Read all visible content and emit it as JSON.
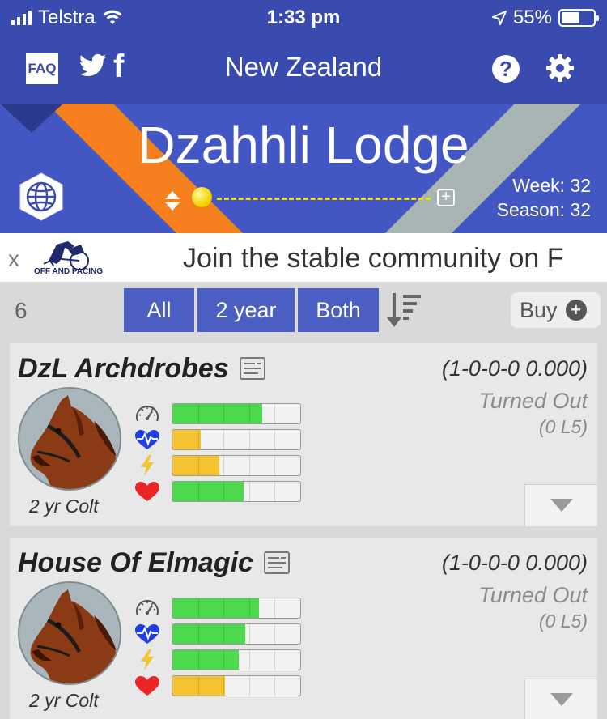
{
  "status_bar": {
    "carrier": "Telstra",
    "time": "1:33 pm",
    "battery": "55%"
  },
  "nav": {
    "faq_label": "FAQ",
    "facebook_glyph": "f",
    "title": "New Zealand",
    "help_glyph": "?"
  },
  "banner": {
    "stable_name": "Dzahhli Lodge",
    "week_label": "Week:",
    "week": "32",
    "season_label": "Season:",
    "season": "32",
    "add_glyph": "+"
  },
  "ad": {
    "close_label": "x",
    "logo_text": "OFF AND PACING",
    "message": "Join the stable community on F"
  },
  "filters": {
    "count": "6",
    "buttons": [
      "All",
      "2 year",
      "Both"
    ],
    "buy_label": "Buy",
    "buy_glyph": "+"
  },
  "horses": [
    {
      "name": "DzL Archdrobes",
      "record": "(1-0-0-0 0.000)",
      "status": "Turned Out",
      "last5": "(0 L5)",
      "description": "2 yr Colt",
      "stats": [
        {
          "icon": "speedometer-icon",
          "level": 0.7,
          "color": "#4cd94c"
        },
        {
          "icon": "heartbeat-icon",
          "level": 0.22,
          "color": "#f4c430"
        },
        {
          "icon": "lightning-icon",
          "level": 0.37,
          "color": "#f4c430"
        },
        {
          "icon": "heart-icon",
          "level": 0.56,
          "color": "#4cd94c"
        }
      ]
    },
    {
      "name": "House Of Elmagic",
      "record": "(1-0-0-0 0.000)",
      "status": "Turned Out",
      "last5": "(0 L5)",
      "description": "2 yr Colt",
      "stats": [
        {
          "icon": "speedometer-icon",
          "level": 0.68,
          "color": "#4cd94c"
        },
        {
          "icon": "heartbeat-icon",
          "level": 0.57,
          "color": "#4cd94c"
        },
        {
          "icon": "lightning-icon",
          "level": 0.52,
          "color": "#4cd94c"
        },
        {
          "icon": "heart-icon",
          "level": 0.41,
          "color": "#f4c430"
        }
      ]
    }
  ],
  "colors": {
    "nav_blue": "#3a4bb0",
    "banner_blue": "#4357c4",
    "filter_blue": "#4a5fc1",
    "stripe_orange": "#f47f1c",
    "stripe_gray": "#a9b4b4"
  }
}
